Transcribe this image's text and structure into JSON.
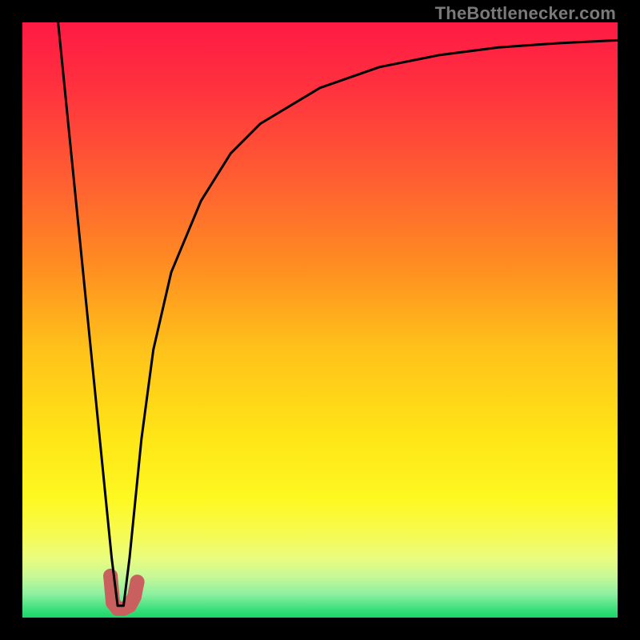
{
  "watermark": "TheBottlenecker.com",
  "colors": {
    "frame": "#000000",
    "line": "#000000",
    "marker": "#c9605f",
    "gradient_stops": [
      {
        "offset": 0.0,
        "color": "#ff1a44"
      },
      {
        "offset": 0.1,
        "color": "#ff2f3f"
      },
      {
        "offset": 0.25,
        "color": "#ff5a33"
      },
      {
        "offset": 0.4,
        "color": "#ff8a22"
      },
      {
        "offset": 0.55,
        "color": "#ffc21a"
      },
      {
        "offset": 0.7,
        "color": "#ffe617"
      },
      {
        "offset": 0.8,
        "color": "#fef821"
      },
      {
        "offset": 0.86,
        "color": "#f6fb52"
      },
      {
        "offset": 0.9,
        "color": "#eafc7e"
      },
      {
        "offset": 0.93,
        "color": "#c9f897"
      },
      {
        "offset": 0.96,
        "color": "#8ef0a0"
      },
      {
        "offset": 0.985,
        "color": "#3fe07e"
      },
      {
        "offset": 1.0,
        "color": "#17d667"
      }
    ]
  },
  "chart_data": {
    "type": "line",
    "title": "",
    "xlabel": "",
    "ylabel": "",
    "xlim": [
      0,
      100
    ],
    "ylim": [
      0,
      100
    ],
    "grid": false,
    "series": [
      {
        "name": "bottleneck-curve",
        "x": [
          6,
          8,
          10,
          12,
          14,
          15,
          16,
          17,
          18,
          20,
          22,
          25,
          30,
          35,
          40,
          50,
          60,
          70,
          80,
          90,
          100
        ],
        "y": [
          100,
          80,
          60,
          40,
          20,
          10,
          2,
          2,
          10,
          30,
          45,
          58,
          70,
          78,
          83,
          89,
          92.5,
          94.5,
          95.8,
          96.5,
          97
        ]
      }
    ],
    "markers": {
      "name": "highlighted-points",
      "color": "#c9605f",
      "points": [
        {
          "x": 14.8,
          "y": 7
        },
        {
          "x": 15.2,
          "y": 2.5
        },
        {
          "x": 16.0,
          "y": 1.5
        },
        {
          "x": 17.0,
          "y": 1.5
        },
        {
          "x": 18.0,
          "y": 2.0
        },
        {
          "x": 18.8,
          "y": 3.5
        },
        {
          "x": 19.3,
          "y": 6.0
        }
      ]
    }
  }
}
